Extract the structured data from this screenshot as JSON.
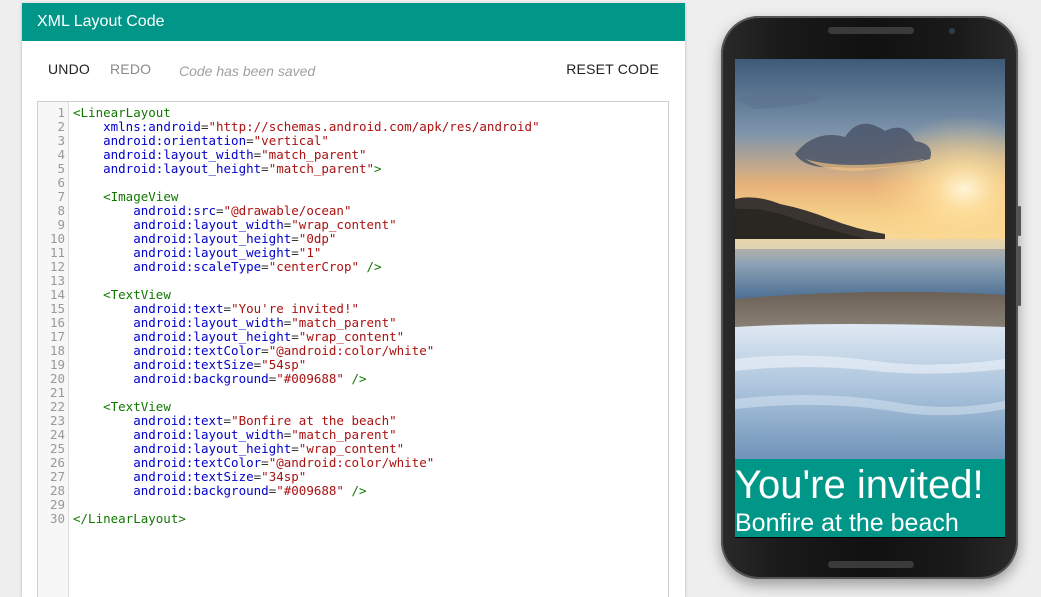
{
  "panel": {
    "title": "XML Layout Code",
    "toolbar": {
      "undo": "UNDO",
      "redo": "REDO",
      "status": "Code has been saved",
      "reset": "RESET CODE"
    }
  },
  "colors": {
    "accent": "#009688",
    "tag": "#117700",
    "attribute": "#0000cc",
    "string": "#aa1111",
    "line_number": "#999999"
  },
  "editor": {
    "line_numbers": [
      "1",
      "2",
      "3",
      "4",
      "5",
      "6",
      "7",
      "8",
      "9",
      "10",
      "11",
      "12",
      "13",
      "14",
      "15",
      "16",
      "17",
      "18",
      "19",
      "20",
      "21",
      "22",
      "23",
      "24",
      "25",
      "26",
      "27",
      "28",
      "29",
      "30"
    ],
    "lines": [
      "<LinearLayout",
      "    xmlns:android=\"http://schemas.android.com/apk/res/android\"",
      "    android:orientation=\"vertical\"",
      "    android:layout_width=\"match_parent\"",
      "    android:layout_height=\"match_parent\">",
      "",
      "    <ImageView",
      "        android:src=\"@drawable/ocean\"",
      "        android:layout_width=\"wrap_content\"",
      "        android:layout_height=\"0dp\"",
      "        android:layout_weight=\"1\"",
      "        android:scaleType=\"centerCrop\" />",
      "",
      "    <TextView",
      "        android:text=\"You're invited!\"",
      "        android:layout_width=\"match_parent\"",
      "        android:layout_height=\"wrap_content\"",
      "        android:textColor=\"@android:color/white\"",
      "        android:textSize=\"54sp\"",
      "        android:background=\"#009688\" />",
      "",
      "    <TextView",
      "        android:text=\"Bonfire at the beach\"",
      "        android:layout_width=\"match_parent\"",
      "        android:layout_height=\"wrap_content\"",
      "        android:textColor=\"@android:color/white\"",
      "        android:textSize=\"34sp\"",
      "        android:background=\"#009688\" />",
      "",
      "</LinearLayout>"
    ]
  },
  "preview": {
    "title": "You're invited!",
    "subtitle": "Bonfire at the beach"
  }
}
